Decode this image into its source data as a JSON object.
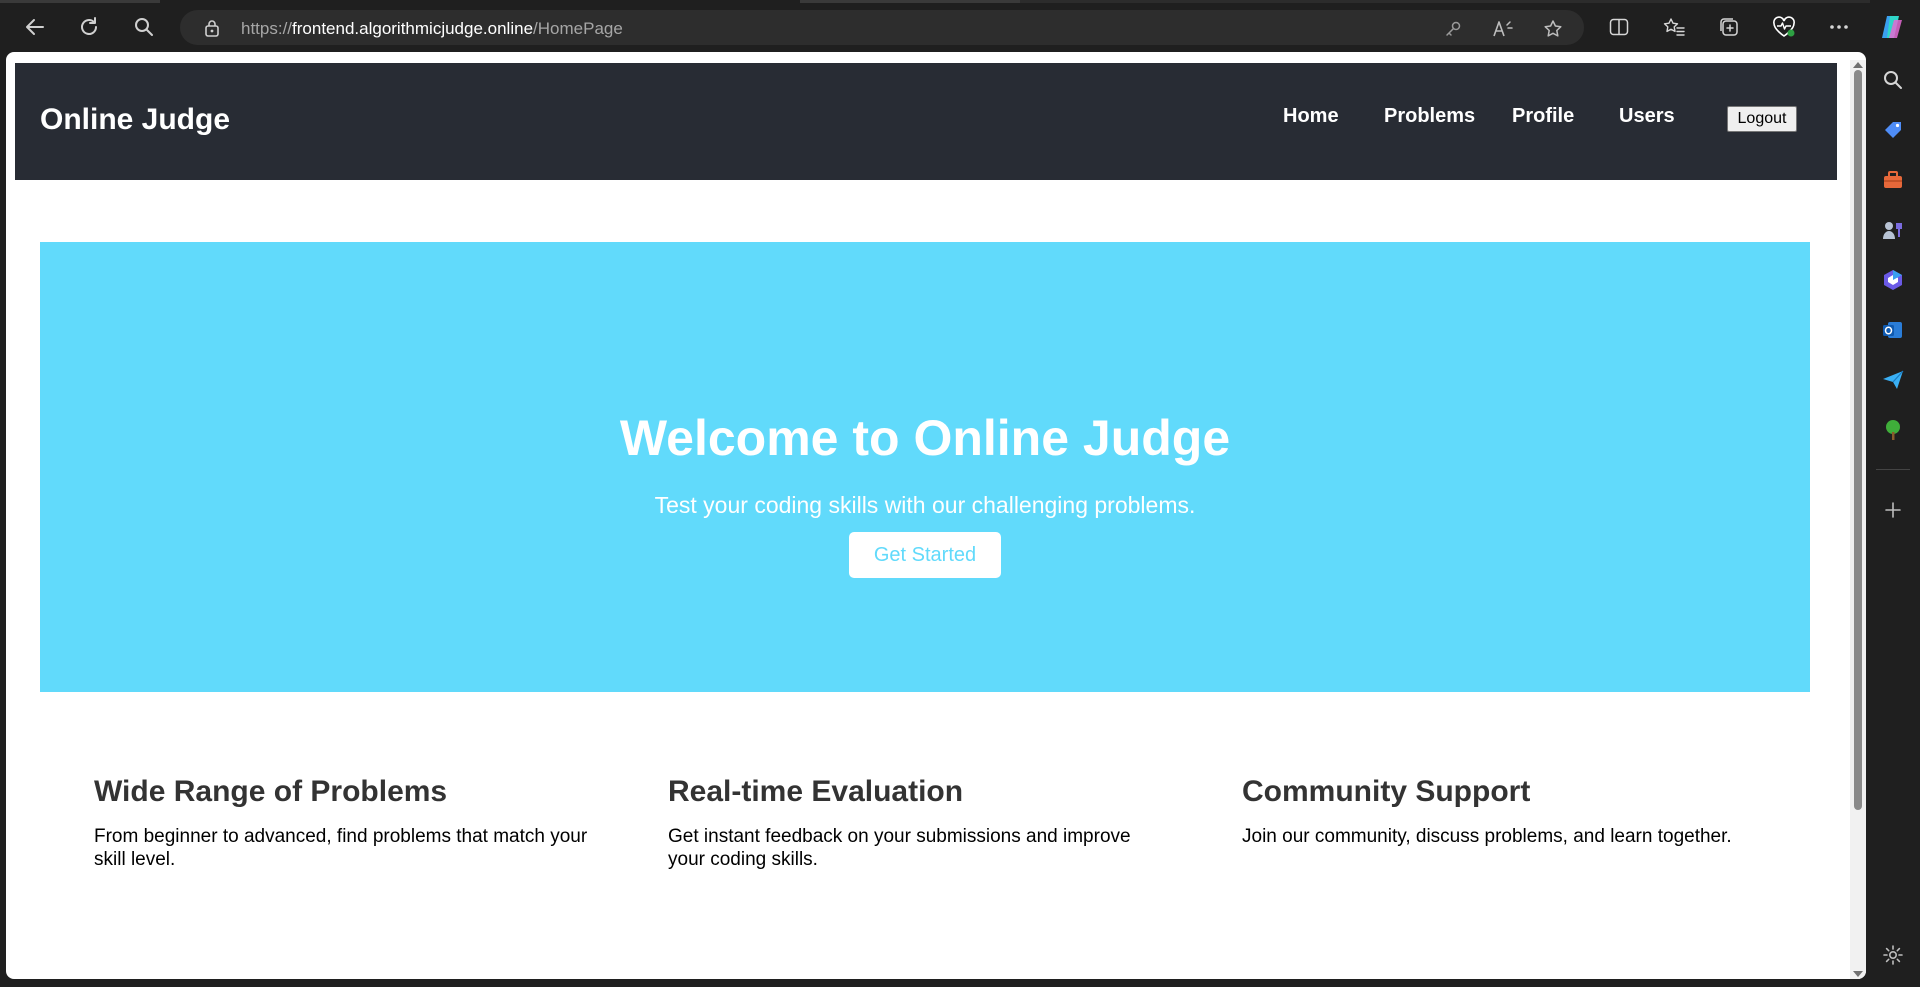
{
  "browser": {
    "url_prefix": "https://",
    "url_host": "frontend.algorithmicjudge.online",
    "url_path": "/HomePage"
  },
  "site": {
    "brand": "Online Judge",
    "nav": [
      {
        "label": "Home"
      },
      {
        "label": "Problems"
      },
      {
        "label": "Profile"
      },
      {
        "label": "Users"
      }
    ],
    "logout_label": "Logout"
  },
  "hero": {
    "title": "Welcome to Online Judge",
    "subtitle": "Test your coding skills with our challenging problems.",
    "cta_label": "Get Started"
  },
  "features": [
    {
      "title": "Wide Range of Problems",
      "text": "From beginner to advanced, find problems that match your skill level."
    },
    {
      "title": "Real-time Evaluation",
      "text": "Get instant feedback on your submissions and improve your coding skills."
    },
    {
      "title": "Community Support",
      "text": "Join our community, discuss problems, and learn together."
    }
  ],
  "colors": {
    "header_bg": "#282c34",
    "hero_bg": "#61dafb",
    "hero_cta_text": "#61dafb",
    "feature_title": "#333333"
  },
  "icons": {
    "toolbar": [
      "back-icon",
      "refresh-icon",
      "search-icon",
      "lock-icon",
      "key-icon",
      "read-aloud-icon",
      "favorite-star-icon",
      "split-screen-icon",
      "favorites-icon",
      "collections-icon",
      "browser-essentials-icon",
      "more-icon",
      "copilot-icon"
    ],
    "sidebar": [
      "sidebar-search-icon",
      "shopping-tag-icon",
      "tools-icon",
      "games-icon",
      "office-icon",
      "outlook-icon",
      "send-icon",
      "tree-icon",
      "add-icon",
      "settings-icon"
    ]
  }
}
